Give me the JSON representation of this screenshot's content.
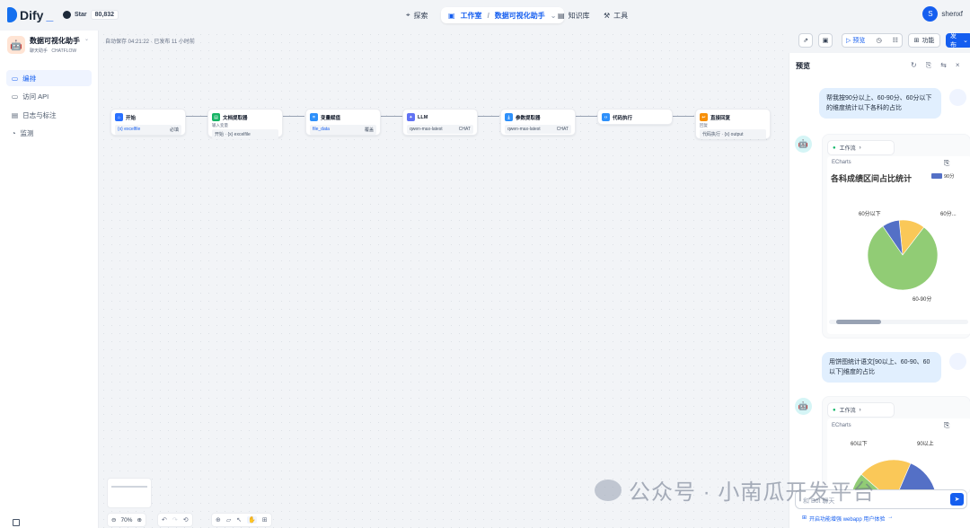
{
  "topbar": {
    "brand": "Dify",
    "star_label": "Star",
    "star_count": "80,832",
    "nav": [
      {
        "label": "探索",
        "icon": "compass-icon"
      },
      {
        "label": "工作室",
        "icon": "grid-icon"
      },
      {
        "label": "数据可视化助手",
        "icon": "chevron-down-icon"
      },
      {
        "label": "知识库",
        "icon": "book-icon"
      },
      {
        "label": "工具",
        "icon": "tool-icon"
      }
    ],
    "user_initial": "S",
    "user_name": "shenxf"
  },
  "sidebar": {
    "app_name": "数据可视化助手",
    "app_type": "聊天助手",
    "app_mode": "CHATFLOW",
    "items": [
      {
        "label": "编排",
        "icon": "layout-icon"
      },
      {
        "label": "访问 API",
        "icon": "terminal-icon"
      },
      {
        "label": "日志与标注",
        "icon": "file-text-icon"
      },
      {
        "label": "监测",
        "icon": "gauge-icon"
      }
    ]
  },
  "canvas": {
    "autosave": "自动保存 04:21:22 · 已发布 11 小时前",
    "zoom": "70%",
    "nodes": [
      {
        "title": "开始",
        "color": "#2970ff",
        "row": "{x} excelfile",
        "tag": "必填"
      },
      {
        "title": "文档提取器",
        "color": "#16b364",
        "sub": "输入变量",
        "row": "开始 · {x} excelfile",
        "tag": ""
      },
      {
        "title": "变量赋值",
        "color": "#2e90fa",
        "row": "file_data",
        "tag": "覆盖"
      },
      {
        "title": "LLM",
        "color": "#6172f3",
        "row": "qwen-max-latest",
        "tag": "CHAT"
      },
      {
        "title": "参数提取器",
        "color": "#2e90fa",
        "row": "qwen-max-latest",
        "tag": "CHAT"
      },
      {
        "title": "代码执行",
        "color": "#2e90fa",
        "row": "",
        "tag": ""
      },
      {
        "title": "直接回复",
        "color": "#f79009",
        "sub": "回复",
        "row": "代码执行 · {x} output",
        "tag": ""
      }
    ]
  },
  "toolbar": {
    "preview_label": "预览",
    "features_label": "功能",
    "publish_label": "发布"
  },
  "preview": {
    "title": "预览",
    "messages": [
      {
        "role": "user",
        "text": "帮我按90分以上、60-90分、60分以下的维度统计以下各科的占比"
      },
      {
        "role": "bot",
        "workflow_label": "工作流",
        "chart_label": "ECharts",
        "chart_title": "各科成绩区间占比统计",
        "legend_label": "90分..."
      },
      {
        "role": "user",
        "text": "用饼图统计语文[90以上、60-90、60以下]维度的占比"
      },
      {
        "role": "bot",
        "workflow_label": "工作流",
        "chart_label": "ECharts"
      }
    ],
    "input_placeholder": "和 Bot 聊天",
    "footer_note": "开启功能增强 webapp 用户体验"
  },
  "chart_data": [
    {
      "type": "pie",
      "title": "各科成绩区间占比统计",
      "legend": [
        "90分..."
      ],
      "labels": [
        "60分以下",
        "60-90分",
        "60分..."
      ],
      "values": [
        12,
        80,
        8
      ],
      "colors": [
        "#fac858",
        "#91cc75",
        "#5470c6"
      ]
    },
    {
      "type": "pie",
      "title": "",
      "labels": [
        "60以下",
        "90以上"
      ],
      "values": [
        20,
        15,
        65
      ],
      "colors": [
        "#fac858",
        "#5470c6",
        "#91cc75"
      ]
    }
  ],
  "watermark": "公众号 · 小南瓜开发平台"
}
